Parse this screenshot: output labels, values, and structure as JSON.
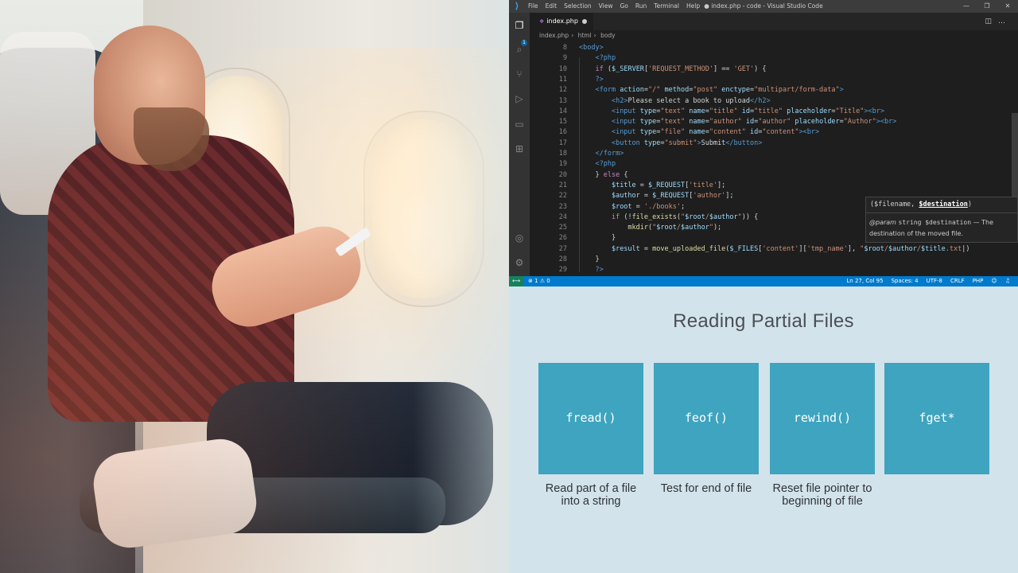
{
  "vscode": {
    "window_title": "● index.php - code - Visual Studio Code",
    "menu": [
      "File",
      "Edit",
      "Selection",
      "View",
      "Go",
      "Run",
      "Terminal",
      "Help"
    ],
    "activity_badge": "1",
    "tab": {
      "label": "index.php"
    },
    "breadcrumbs": [
      "index.php",
      "html",
      "body"
    ],
    "code_lines": [
      {
        "n": "8",
        "segs": [
          [
            "tag",
            "<body>"
          ]
        ]
      },
      {
        "n": "9",
        "segs": [
          [
            "txt",
            "    "
          ],
          [
            "php",
            "<?php"
          ]
        ]
      },
      {
        "n": "10",
        "segs": [
          [
            "txt",
            "    "
          ],
          [
            "kw",
            "if"
          ],
          [
            "txt",
            " ("
          ],
          [
            "var",
            "$_SERVER"
          ],
          [
            "txt",
            "["
          ],
          [
            "str",
            "'REQUEST_METHOD'"
          ],
          [
            "txt",
            "] == "
          ],
          [
            "str",
            "'GET'"
          ],
          [
            "txt",
            ") {"
          ]
        ]
      },
      {
        "n": "11",
        "segs": [
          [
            "txt",
            "    "
          ],
          [
            "php",
            "?>"
          ]
        ]
      },
      {
        "n": "12",
        "segs": [
          [
            "txt",
            "    "
          ],
          [
            "tag",
            "<form "
          ],
          [
            "attr",
            "action"
          ],
          [
            "txt",
            "="
          ],
          [
            "str",
            "\"/\""
          ],
          [
            "txt",
            " "
          ],
          [
            "attr",
            "method"
          ],
          [
            "txt",
            "="
          ],
          [
            "str",
            "\"post\""
          ],
          [
            "txt",
            " "
          ],
          [
            "attr",
            "enctype"
          ],
          [
            "txt",
            "="
          ],
          [
            "str",
            "\"multipart/form-data\""
          ],
          [
            "tag",
            ">"
          ]
        ]
      },
      {
        "n": "13",
        "segs": [
          [
            "txt",
            "        "
          ],
          [
            "tag",
            "<h2>"
          ],
          [
            "txt",
            "Please select a book to upload"
          ],
          [
            "tag",
            "</h2>"
          ]
        ]
      },
      {
        "n": "14",
        "segs": [
          [
            "txt",
            "        "
          ],
          [
            "tag",
            "<input "
          ],
          [
            "attr",
            "type"
          ],
          [
            "txt",
            "="
          ],
          [
            "str",
            "\"text\""
          ],
          [
            "txt",
            " "
          ],
          [
            "attr",
            "name"
          ],
          [
            "txt",
            "="
          ],
          [
            "str",
            "\"title\""
          ],
          [
            "txt",
            " "
          ],
          [
            "attr",
            "id"
          ],
          [
            "txt",
            "="
          ],
          [
            "str",
            "\"title\""
          ],
          [
            "txt",
            " "
          ],
          [
            "attr",
            "placeholder"
          ],
          [
            "txt",
            "="
          ],
          [
            "str",
            "\"Title\""
          ],
          [
            "tag",
            "><br>"
          ]
        ]
      },
      {
        "n": "15",
        "segs": [
          [
            "txt",
            "        "
          ],
          [
            "tag",
            "<input "
          ],
          [
            "attr",
            "type"
          ],
          [
            "txt",
            "="
          ],
          [
            "str",
            "\"text\""
          ],
          [
            "txt",
            " "
          ],
          [
            "attr",
            "name"
          ],
          [
            "txt",
            "="
          ],
          [
            "str",
            "\"author\""
          ],
          [
            "txt",
            " "
          ],
          [
            "attr",
            "id"
          ],
          [
            "txt",
            "="
          ],
          [
            "str",
            "\"author\""
          ],
          [
            "txt",
            " "
          ],
          [
            "attr",
            "placeholder"
          ],
          [
            "txt",
            "="
          ],
          [
            "str",
            "\"Author\""
          ],
          [
            "tag",
            "><br>"
          ]
        ]
      },
      {
        "n": "16",
        "segs": [
          [
            "txt",
            "        "
          ],
          [
            "tag",
            "<input "
          ],
          [
            "attr",
            "type"
          ],
          [
            "txt",
            "="
          ],
          [
            "str",
            "\"file\""
          ],
          [
            "txt",
            " "
          ],
          [
            "attr",
            "name"
          ],
          [
            "txt",
            "="
          ],
          [
            "str",
            "\"content\""
          ],
          [
            "txt",
            " "
          ],
          [
            "attr",
            "id"
          ],
          [
            "txt",
            "="
          ],
          [
            "str",
            "\"content\""
          ],
          [
            "tag",
            "><br>"
          ]
        ]
      },
      {
        "n": "17",
        "segs": [
          [
            "txt",
            "        "
          ],
          [
            "tag",
            "<button "
          ],
          [
            "attr",
            "type"
          ],
          [
            "txt",
            "="
          ],
          [
            "str",
            "\"submit\""
          ],
          [
            "tag",
            ">"
          ],
          [
            "txt",
            "Submit"
          ],
          [
            "tag",
            "</button>"
          ]
        ]
      },
      {
        "n": "18",
        "segs": [
          [
            "txt",
            "    "
          ],
          [
            "tag",
            "</form>"
          ]
        ]
      },
      {
        "n": "19",
        "segs": [
          [
            "txt",
            "    "
          ],
          [
            "php",
            "<?php"
          ]
        ]
      },
      {
        "n": "20",
        "segs": [
          [
            "txt",
            "    } "
          ],
          [
            "kw",
            "else"
          ],
          [
            "txt",
            " {"
          ]
        ]
      },
      {
        "n": "21",
        "segs": [
          [
            "txt",
            "        "
          ],
          [
            "var",
            "$title"
          ],
          [
            "txt",
            " = "
          ],
          [
            "var",
            "$_REQUEST"
          ],
          [
            "txt",
            "["
          ],
          [
            "str",
            "'title'"
          ],
          [
            "txt",
            "];"
          ]
        ]
      },
      {
        "n": "22",
        "segs": [
          [
            "txt",
            "        "
          ],
          [
            "var",
            "$author"
          ],
          [
            "txt",
            " = "
          ],
          [
            "var",
            "$_REQUEST"
          ],
          [
            "txt",
            "["
          ],
          [
            "str",
            "'author'"
          ],
          [
            "txt",
            "];"
          ]
        ]
      },
      {
        "n": "23",
        "segs": [
          [
            "txt",
            "        "
          ],
          [
            "var",
            "$root"
          ],
          [
            "txt",
            " = "
          ],
          [
            "str",
            "'./books'"
          ],
          [
            "txt",
            ";"
          ]
        ]
      },
      {
        "n": "24",
        "segs": [
          [
            "txt",
            "        "
          ],
          [
            "kw",
            "if"
          ],
          [
            "txt",
            " (!"
          ],
          [
            "fn",
            "file_exists"
          ],
          [
            "txt",
            "("
          ],
          [
            "str",
            "\""
          ],
          [
            "var",
            "$root"
          ],
          [
            "str",
            "/"
          ],
          [
            "var",
            "$author"
          ],
          [
            "str",
            "\""
          ],
          [
            "txt",
            ")) {"
          ]
        ]
      },
      {
        "n": "25",
        "segs": [
          [
            "txt",
            "            "
          ],
          [
            "fn",
            "mkdir"
          ],
          [
            "txt",
            "("
          ],
          [
            "str",
            "\""
          ],
          [
            "var",
            "$root"
          ],
          [
            "str",
            "/"
          ],
          [
            "var",
            "$author"
          ],
          [
            "str",
            "\""
          ],
          [
            "txt",
            ");"
          ]
        ]
      },
      {
        "n": "26",
        "segs": [
          [
            "txt",
            "        }"
          ]
        ]
      },
      {
        "n": "27",
        "segs": [
          [
            "txt",
            "        "
          ],
          [
            "var",
            "$result"
          ],
          [
            "txt",
            " = "
          ],
          [
            "fn",
            "move_uploaded_file"
          ],
          [
            "txt",
            "("
          ],
          [
            "var",
            "$_FILES"
          ],
          [
            "txt",
            "["
          ],
          [
            "str",
            "'content'"
          ],
          [
            "txt",
            "]["
          ],
          [
            "str",
            "'tmp_name'"
          ],
          [
            "txt",
            "], "
          ],
          [
            "str",
            "\""
          ],
          [
            "var",
            "$root"
          ],
          [
            "str",
            "/"
          ],
          [
            "var",
            "$author"
          ],
          [
            "str",
            "/"
          ],
          [
            "var",
            "$title"
          ],
          [
            "str",
            ".txt"
          ],
          [
            "txt",
            "|)"
          ]
        ]
      },
      {
        "n": "28",
        "segs": [
          [
            "txt",
            "    }"
          ]
        ]
      },
      {
        "n": "29",
        "segs": [
          [
            "txt",
            "    "
          ],
          [
            "php",
            "?>"
          ]
        ]
      }
    ],
    "hover": {
      "signature_prefix": "($filename, ",
      "signature_param": "$destination",
      "signature_suffix": ")",
      "doc_tag": "@param",
      "doc_code": "string $destination",
      "doc_text": " — The destination of the moved file."
    },
    "status": {
      "errors": "⊗ 1 ⚠ 0",
      "position": "Ln 27, Col 95",
      "spaces": "Spaces: 4",
      "encoding": "UTF-8",
      "eol": "CRLF",
      "language": "PHP"
    }
  },
  "slide": {
    "title": "Reading Partial Files",
    "cards": [
      {
        "fn": "fread()",
        "desc": "Read part of a file into a string"
      },
      {
        "fn": "feof()",
        "desc": "Test for end of file"
      },
      {
        "fn": "rewind()",
        "desc": "Reset file pointer to beginning of file"
      },
      {
        "fn": "fget*",
        "desc": ""
      }
    ],
    "card_color": "#3ea4bf",
    "background_color": "#d3e3eb"
  }
}
